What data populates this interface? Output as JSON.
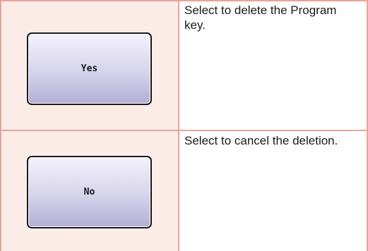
{
  "rows": [
    {
      "button_label": "Yes",
      "description": "Select to delete the Program key."
    },
    {
      "button_label": "No",
      "description": "Select to cancel the deletion."
    }
  ],
  "colors": {
    "border": "#e8a49a",
    "left_cell_bg": "#fcece8",
    "button_top": "#f4f2fb",
    "button_bottom": "#b3afd6"
  }
}
